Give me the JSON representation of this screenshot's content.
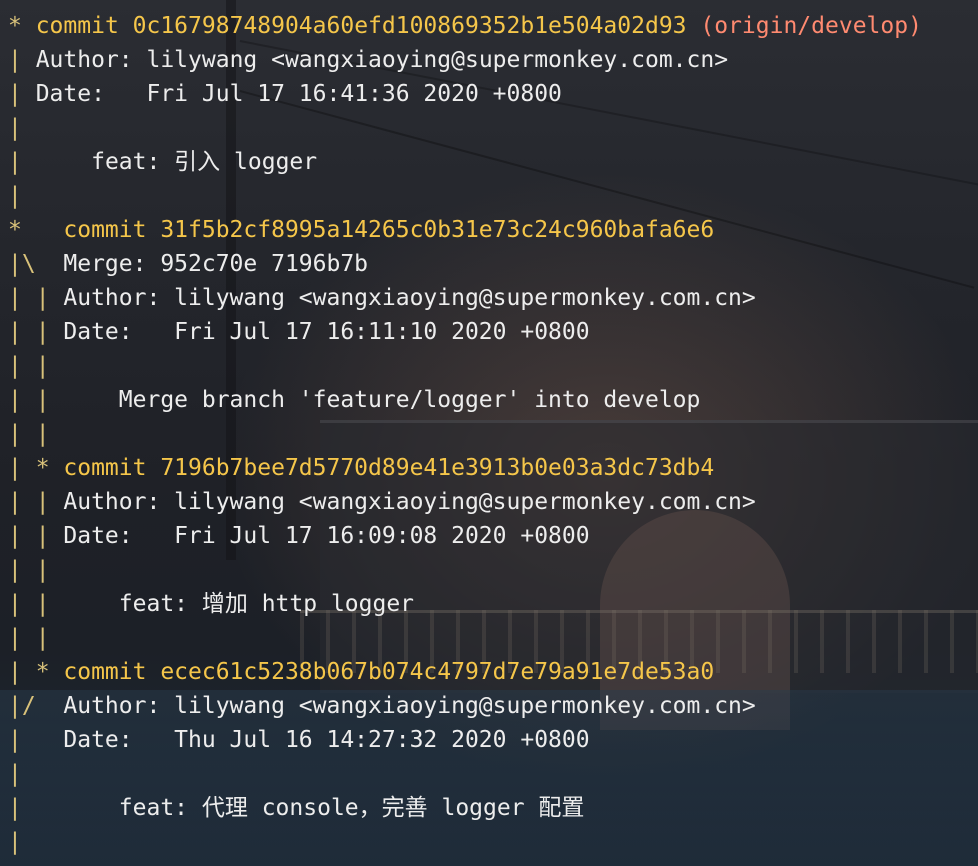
{
  "lines": [
    {
      "graph": "* ",
      "kind": "commit",
      "text": "commit 0c16798748904a60efd100869352b1e504a02d93 ",
      "ref": "(origin/develop)"
    },
    {
      "graph": "| ",
      "kind": "plain",
      "text": "Author: lilywang <wangxiaoying@supermonkey.com.cn>"
    },
    {
      "graph": "| ",
      "kind": "plain",
      "text": "Date:   Fri Jul 17 16:41:36 2020 +0800"
    },
    {
      "graph": "| ",
      "kind": "plain",
      "text": ""
    },
    {
      "graph": "| ",
      "kind": "plain",
      "text": "    feat: 引入 logger"
    },
    {
      "graph": "| ",
      "kind": "plain",
      "text": ""
    },
    {
      "graph": "*   ",
      "kind": "commit",
      "text": "commit 31f5b2cf8995a14265c0b31e73c24c960bafa6e6",
      "ref": ""
    },
    {
      "graph": "|\\  ",
      "kind": "plain",
      "text": "Merge: 952c70e 7196b7b"
    },
    {
      "graph": "| | ",
      "kind": "plain",
      "text": "Author: lilywang <wangxiaoying@supermonkey.com.cn>"
    },
    {
      "graph": "| | ",
      "kind": "plain",
      "text": "Date:   Fri Jul 17 16:11:10 2020 +0800"
    },
    {
      "graph": "| | ",
      "kind": "plain",
      "text": ""
    },
    {
      "graph": "| | ",
      "kind": "plain",
      "text": "    Merge branch 'feature/logger' into develop"
    },
    {
      "graph": "| | ",
      "kind": "plain",
      "text": ""
    },
    {
      "graph": "| * ",
      "kind": "commit",
      "text": "commit 7196b7bee7d5770d89e41e3913b0e03a3dc73db4",
      "ref": ""
    },
    {
      "graph": "| | ",
      "kind": "plain",
      "text": "Author: lilywang <wangxiaoying@supermonkey.com.cn>"
    },
    {
      "graph": "| | ",
      "kind": "plain",
      "text": "Date:   Fri Jul 17 16:09:08 2020 +0800"
    },
    {
      "graph": "| | ",
      "kind": "plain",
      "text": ""
    },
    {
      "graph": "| | ",
      "kind": "plain",
      "text": "    feat: 增加 http logger"
    },
    {
      "graph": "| | ",
      "kind": "plain",
      "text": ""
    },
    {
      "graph": "| * ",
      "kind": "commit",
      "text": "commit ecec61c5238b067b074c4797d7e79a91e7de53a0",
      "ref": ""
    },
    {
      "graph": "|/  ",
      "kind": "plain",
      "text": "Author: lilywang <wangxiaoying@supermonkey.com.cn>"
    },
    {
      "graph": "|   ",
      "kind": "plain",
      "text": "Date:   Thu Jul 16 14:27:32 2020 +0800"
    },
    {
      "graph": "|   ",
      "kind": "plain",
      "text": ""
    },
    {
      "graph": "|   ",
      "kind": "plain",
      "text": "    feat: 代理 console，完善 logger 配置"
    },
    {
      "graph": "|   ",
      "kind": "plain",
      "text": ""
    }
  ],
  "colors": {
    "graph": "#d9c27a",
    "commit_hash": "#f5c64a",
    "ref_decoration": "#ff8a70",
    "text": "#ededed"
  }
}
